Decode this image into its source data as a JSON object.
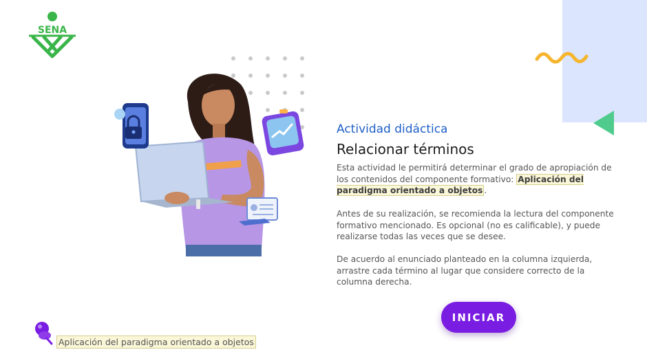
{
  "brand": {
    "logo_text": "SENA",
    "logo_color": "#39b54a"
  },
  "content": {
    "subtitle": "Actividad didáctica",
    "title": "Relacionar términos",
    "p1_text": "Esta actividad le permitirá determinar el grado de apropiación de los contenidos del componente formativo: ",
    "p1_highlight": "Aplicación del paradigma orientado a objetos",
    "p1_end": ".",
    "p2_text": "Antes de su realización, se recomienda la lectura del componente formativo mencionado.  Es opcional (no es calificable), y puede realizarse todas las veces que se desee.",
    "p3_text": "De acuerdo al enunciado planteado en la columna izquierda, arrastre cada término al lugar que considere correcto de la columna derecha."
  },
  "start_button": {
    "label": "INICIAR"
  },
  "footer": {
    "component_label": "Aplicación del paradigma orientado a objetos"
  },
  "colors": {
    "accent_purple": "#7a1de2",
    "title_blue": "#1f5fc7",
    "panel_blue": "#dbe5fe",
    "wave_yellow": "#f5b52e",
    "arrow_green": "#4ecb8d",
    "highlight_bg": "#faf6d8"
  },
  "icons": [
    "sena-logo",
    "wavy-line-icon",
    "triangle-arrow-icon",
    "pushpin-icon",
    "lock-phone-icon",
    "chart-card-icon",
    "document-card-icon"
  ]
}
